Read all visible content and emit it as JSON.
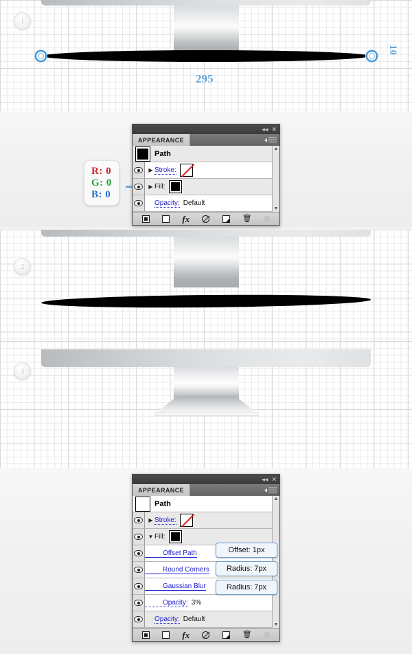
{
  "steps": [
    {
      "num": "1"
    },
    {
      "num": "2"
    },
    {
      "num": "3"
    }
  ],
  "measurements": {
    "width_label": "295",
    "height_label": "10"
  },
  "rgb_callout": {
    "r": "R: 0",
    "g": "G: 0",
    "b": "B: 0"
  },
  "panel_top": {
    "tab_label": "APPEARANCE",
    "collapse_icon": "◂◂",
    "close_icon": "✕",
    "object_label": "Path",
    "rows": [
      {
        "label": "Stroke:",
        "value": "",
        "swatch": "none",
        "disclosure": "▶"
      },
      {
        "label": "Fill:",
        "value": "",
        "swatch": "black",
        "disclosure": "▶"
      },
      {
        "label": "Opacity:",
        "value": "Default",
        "swatch": "",
        "disclosure": ""
      }
    ],
    "footer_icons": [
      "add-new-stroke-icon",
      "add-new-fill-icon",
      "add-new-effect-icon",
      "clear-appearance-icon",
      "duplicate-item-icon",
      "delete-item-icon"
    ]
  },
  "panel_bottom": {
    "tab_label": "APPEARANCE",
    "collapse_icon": "◂◂",
    "close_icon": "✕",
    "object_label": "Path",
    "rows": [
      {
        "label": "Stroke:",
        "value": "",
        "swatch": "none",
        "disclosure": "▶",
        "indent": false
      },
      {
        "label": "Fill:",
        "value": "",
        "swatch": "black",
        "disclosure": "▼",
        "indent": false
      },
      {
        "label": "Offset Path",
        "value": "",
        "swatch": "",
        "disclosure": "",
        "indent": true
      },
      {
        "label": "Round Corners",
        "value": "",
        "swatch": "",
        "disclosure": "",
        "indent": true
      },
      {
        "label": "Gaussian Blur",
        "value": "",
        "swatch": "",
        "disclosure": "",
        "indent": true
      },
      {
        "label": "Opacity:",
        "value": "3%",
        "swatch": "",
        "disclosure": "",
        "indent": true
      },
      {
        "label": "Opacity:",
        "value": "Default",
        "swatch": "",
        "disclosure": "",
        "indent": false
      }
    ],
    "footer_icons": [
      "add-new-stroke-icon",
      "add-new-fill-icon",
      "add-new-effect-icon",
      "clear-appearance-icon",
      "duplicate-item-icon",
      "delete-item-icon"
    ]
  },
  "tooltips": [
    {
      "text": "Offset: 1px"
    },
    {
      "text": "Radius: 7px"
    },
    {
      "text": "Radius: 7px"
    }
  ],
  "colors": {
    "accent_blue": "#5fa8e0",
    "tooltip_border": "#6f9fd1",
    "link_blue": "#2222cc",
    "shadow_black": "#000000"
  }
}
